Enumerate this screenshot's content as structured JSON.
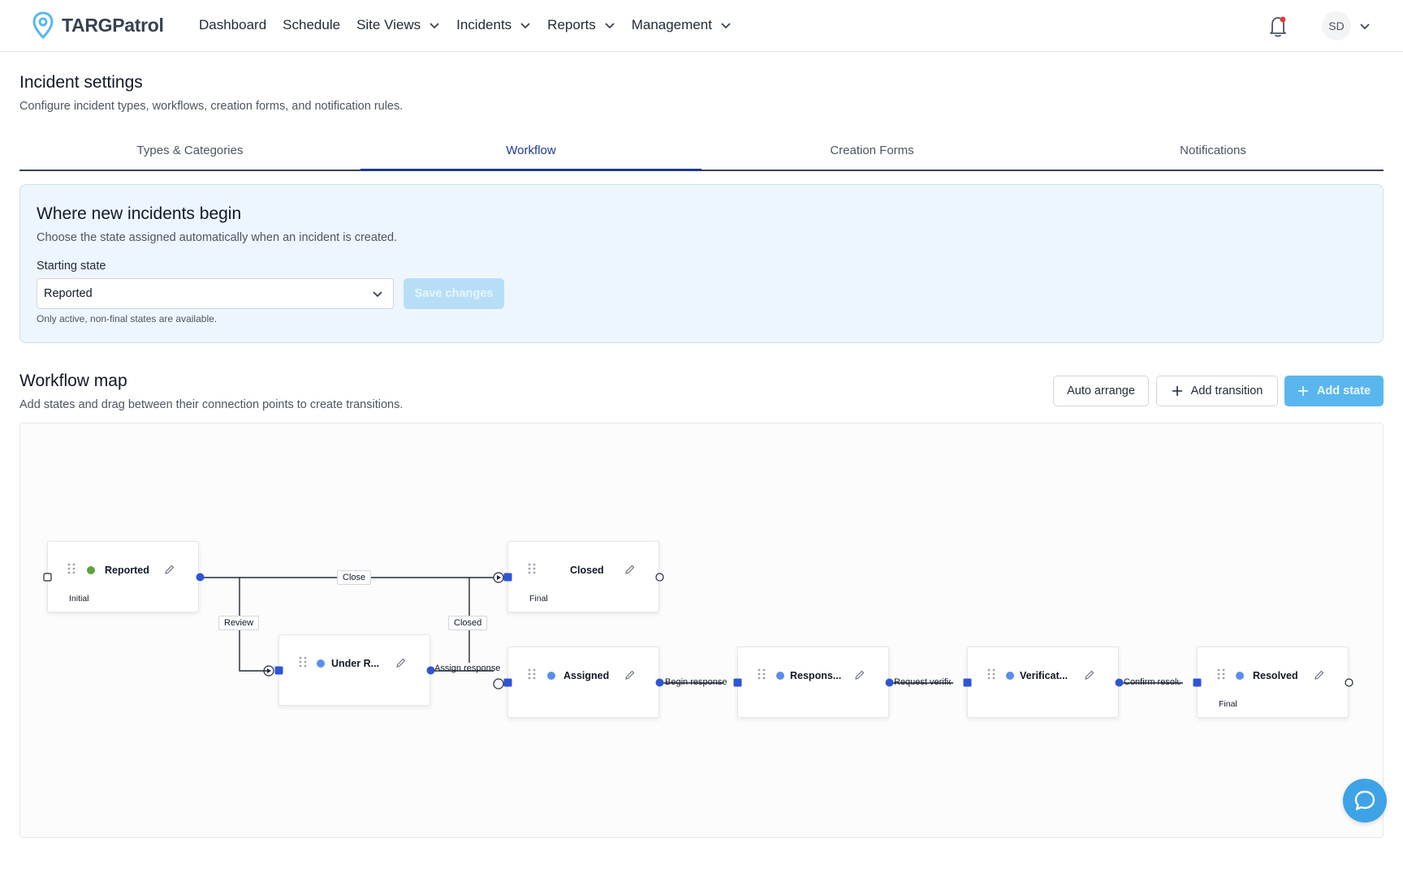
{
  "app": {
    "brand": "TARGPatrol"
  },
  "nav": {
    "items": [
      {
        "label": "Dashboard",
        "dropdown": false
      },
      {
        "label": "Schedule",
        "dropdown": false
      },
      {
        "label": "Site Views",
        "dropdown": true
      },
      {
        "label": "Incidents",
        "dropdown": true
      },
      {
        "label": "Reports",
        "dropdown": true
      },
      {
        "label": "Management",
        "dropdown": true
      }
    ],
    "user_initials": "SD"
  },
  "header": {
    "title": "Incident settings",
    "subtitle": "Configure incident types, workflows, creation forms, and notification rules."
  },
  "tabs": [
    {
      "label": "Types & Categories",
      "active": false
    },
    {
      "label": "Workflow",
      "active": true
    },
    {
      "label": "Creation Forms",
      "active": false
    },
    {
      "label": "Notifications",
      "active": false
    }
  ],
  "start": {
    "title": "Where new incidents begin",
    "subtitle": "Choose the state assigned automatically when an incident is created.",
    "label": "Starting state",
    "selected": "Reported",
    "save_label": "Save changes",
    "hint": "Only active, non-final states are available."
  },
  "workflow": {
    "title": "Workflow map",
    "subtitle": "Add states and drag between their connection points to create transitions.",
    "auto_arrange": "Auto arrange",
    "add_transition": "Add transition",
    "add_state": "Add state",
    "nodes": [
      {
        "name": "Reported",
        "tag": "Initial",
        "dot_color": "#5ba33b"
      },
      {
        "name": "Closed",
        "tag": "Final",
        "dot_color": ""
      },
      {
        "name": "Under R...",
        "tag": "",
        "dot_color": "#5b8def"
      },
      {
        "name": "Assigned",
        "tag": "",
        "dot_color": "#5b8def"
      },
      {
        "name": "Respons...",
        "tag": "",
        "dot_color": "#5b8def"
      },
      {
        "name": "Verificat...",
        "tag": "",
        "dot_color": "#5b8def"
      },
      {
        "name": "Resolved",
        "tag": "Final",
        "dot_color": "#5b8def"
      }
    ],
    "edges": {
      "close": "Close",
      "review": "Review",
      "closed": "Closed",
      "assign": "Assign response",
      "begin": "Begin response",
      "verify": "Request verifica",
      "confirm": "Confirm resoluti"
    }
  },
  "colors": {
    "accent": "#5ab6ee",
    "handle": "#2f55d4",
    "tab_active": "#1e3a8a"
  }
}
